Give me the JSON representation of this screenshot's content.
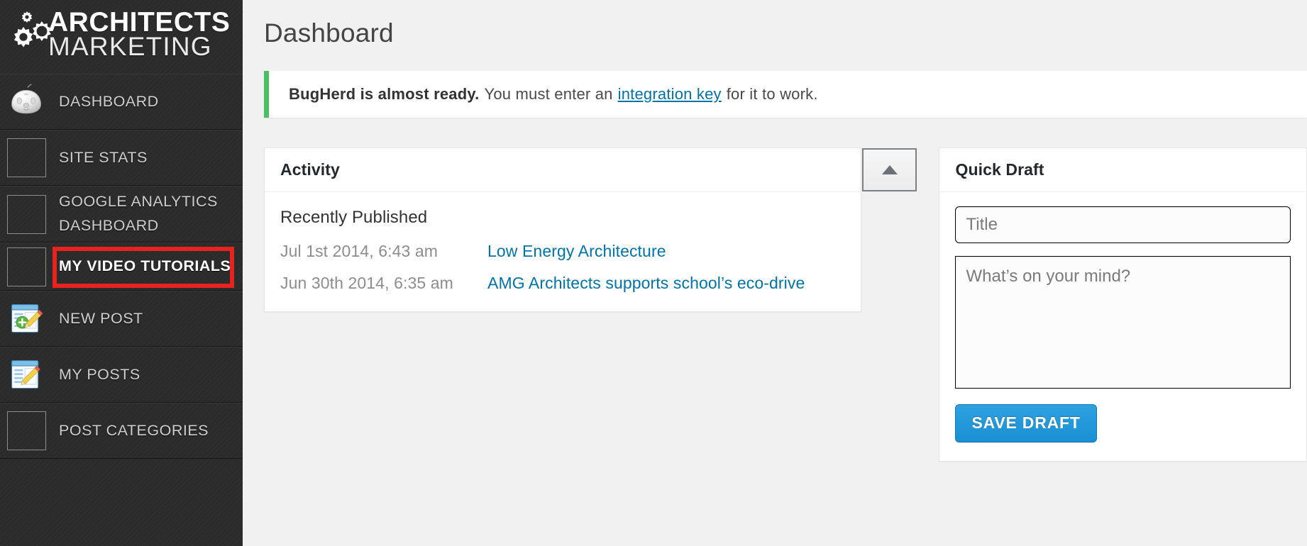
{
  "sidebar": {
    "logo": {
      "line1": "ARCHITECTS",
      "line2": "MARKETING",
      "icon": "gears-icon"
    },
    "items": [
      {
        "label": "DASHBOARD",
        "icon": "wordpress-dashboard-icon",
        "icon_type": "image",
        "highlighted": false
      },
      {
        "label": "SITE STATS",
        "icon": "missing-image-icon",
        "icon_type": "placeholder",
        "highlighted": false
      },
      {
        "label": "GOOGLE ANALYTICS DASHBOARD",
        "icon": "missing-image-icon",
        "icon_type": "placeholder",
        "highlighted": false
      },
      {
        "label": "MY VIDEO TUTORIALS",
        "icon": "missing-image-icon",
        "icon_type": "placeholder",
        "highlighted": true
      },
      {
        "label": "NEW POST",
        "icon": "new-post-icon",
        "icon_type": "image",
        "highlighted": false
      },
      {
        "label": "MY POSTS",
        "icon": "my-posts-icon",
        "icon_type": "image",
        "highlighted": false
      },
      {
        "label": "POST CATEGORIES",
        "icon": "missing-image-icon",
        "icon_type": "placeholder",
        "highlighted": false
      }
    ]
  },
  "main": {
    "page_title": "Dashboard",
    "notice": {
      "bold_text": "BugHerd is almost ready.",
      "text_before_link": "You must enter an",
      "link_text": "integration key",
      "text_after_link": "for it to work.",
      "accent_color": "#49c160"
    },
    "activity": {
      "title": "Activity",
      "collapse_icon": "caret-up-icon",
      "section_heading": "Recently Published",
      "entries": [
        {
          "date": "Jul 1st 2014, 6:43 am",
          "title": "Low Energy Architecture"
        },
        {
          "date": "Jun 30th 2014, 6:35 am",
          "title": "AMG Architects supports school’s eco-drive"
        }
      ]
    },
    "quick_draft": {
      "title": "Quick Draft",
      "title_placeholder": "Title",
      "title_value": "",
      "content_placeholder": "What’s on your mind?",
      "content_value": "",
      "save_label": "SAVE DRAFT",
      "save_color": "#1e8cbe"
    }
  },
  "annotation": {
    "highlight_color": "#e8231f"
  }
}
